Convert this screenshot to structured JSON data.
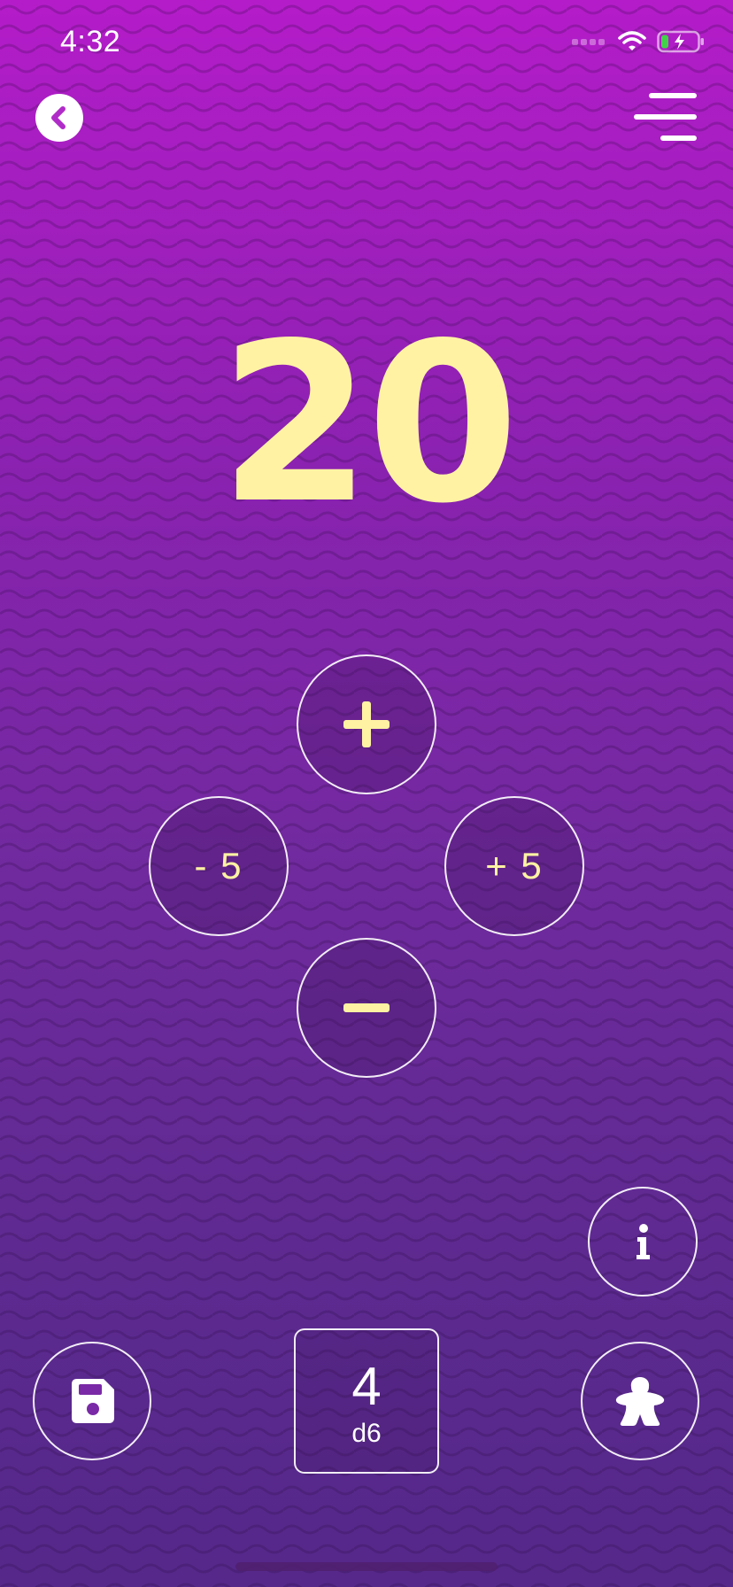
{
  "status_bar": {
    "time": "4:32"
  },
  "counter": {
    "value": "20"
  },
  "controls": {
    "increment_label": "+",
    "decrement_label": "−",
    "minus_five_label": "- 5",
    "plus_five_label": "+ 5"
  },
  "dice": {
    "value": "4",
    "type": "d6"
  },
  "icons": {
    "back": "chevron-left-icon",
    "menu": "menu-icon",
    "info": "info-icon",
    "save": "floppy-disk-icon",
    "player": "meeple-icon"
  },
  "colors": {
    "accent": "#fff3a3",
    "gradient_top": "#b41cc9",
    "gradient_bottom": "#55288a"
  }
}
